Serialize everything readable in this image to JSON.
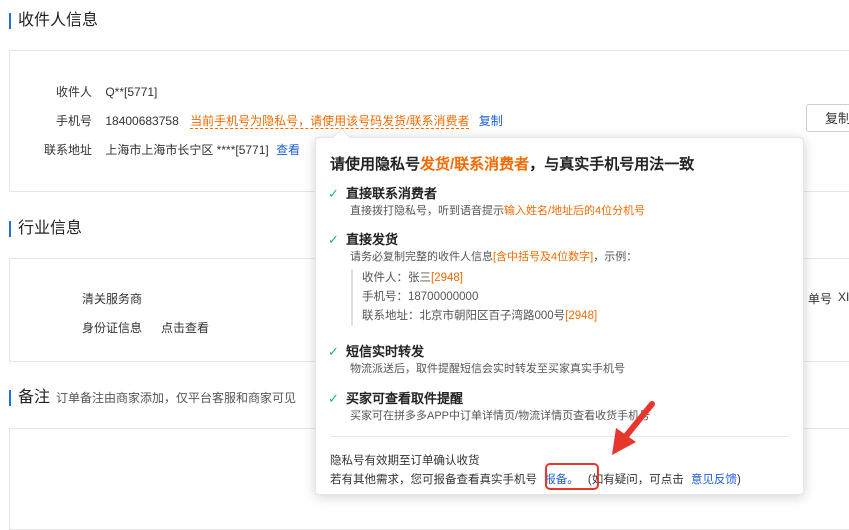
{
  "recipient_section": {
    "title": "收件人信息",
    "name_label": "收件人",
    "name_value": "Q**[5771]",
    "phone_label": "手机号",
    "phone_value": "18400683758",
    "phone_notice": "当前手机号为隐私号，请使用该号码发货/联系消费者",
    "copy_link": "复制",
    "address_label": "联系地址",
    "address_value": "上海市上海市长宁区 ****[5771]",
    "view_link": "查看",
    "copy_button": "复制"
  },
  "industry_section": {
    "title": "行业信息",
    "customs_label": "清关服务商",
    "id_label": "身份证信息",
    "id_link": "点击查看",
    "right_fragment": "单号",
    "right_value": "XI"
  },
  "remark_section": {
    "title": "备注",
    "subtitle": "订单备注由商家添加，仅平台客服和商家可见"
  },
  "popover": {
    "title_prefix": "请使用隐私号",
    "title_highlight": "发货/联系消费者",
    "title_suffix": "，与真实手机号用法一致",
    "check_glyph": "✓",
    "features": [
      {
        "title": "直接联系消费者",
        "desc_prefix": "直接拨打隐私号，听到语音提示",
        "desc_highlight": "输入姓名/地址后的4位分机号",
        "desc_suffix": ""
      },
      {
        "title": "直接发货",
        "desc_prefix": "请务必复制完整的收件人信息",
        "desc_highlight": "[含中括号及4位数字]",
        "desc_suffix": "，示例："
      },
      {
        "title": "短信实时转发",
        "desc_prefix": "物流派送后，取件提醒短信会实时转发至买家真实手机号",
        "desc_highlight": "",
        "desc_suffix": ""
      },
      {
        "title": "买家可查看取件提醒",
        "desc_prefix": "买家可在拼多多APP中订单详情页/物流详情页查看收货手机号",
        "desc_highlight": "",
        "desc_suffix": ""
      }
    ],
    "example": {
      "line1_prefix": "收件人：张三",
      "line1_code": "[2948]",
      "line2": "手机号：18700000000",
      "line3_prefix": "联系地址：北京市朝阳区百子湾路000号",
      "line3_code": "[2948]"
    },
    "footer_line1": "隐私号有效期至订单确认收货",
    "footer_line2_prefix": "若有其他需求，您可报备查看真实手机号",
    "report_link": "报备。",
    "footer_line2_mid": "(如有疑问，可点击",
    "feedback_link": "意见反馈",
    "footer_line2_end": ")"
  },
  "colors": {
    "accent_blue": "#1f5fd8",
    "highlight_orange": "#f56a00",
    "check_green": "#2bb673",
    "annotation_red": "#e8362d"
  }
}
